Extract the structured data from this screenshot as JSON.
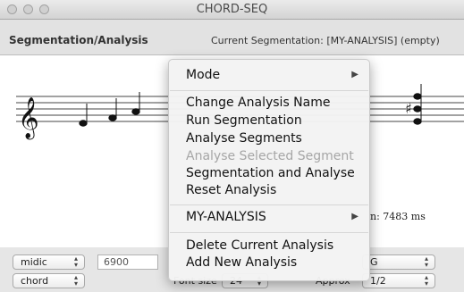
{
  "window": {
    "title": "CHORD-SEQ"
  },
  "toolbar": {
    "section_label": "Segmentation/Analysis",
    "current_segmentation": "Current Segmentation:  [MY-ANALYSIS] (empty)"
  },
  "canvas": {
    "duration_fragment": "n: 7483 ms"
  },
  "bottom": {
    "row1": {
      "format_select": "midic",
      "value_field": "6900",
      "key_select": "G"
    },
    "row2": {
      "mode_select": "chord",
      "font_size_label": "Font size",
      "font_size_select": "24",
      "approx_label": "Approx",
      "approx_select": "1/2"
    }
  },
  "context_menu": {
    "mode": "Mode",
    "change_name": "Change Analysis Name",
    "run_segmentation": "Run Segmentation",
    "analyse_segments": "Analyse Segments",
    "analyse_selected": "Analyse Selected Segment",
    "seg_and_analyse": "Segmentation and Analyse",
    "reset": "Reset Analysis",
    "my_analysis": "MY-ANALYSIS",
    "delete_current": "Delete Current Analysis",
    "add_new": "Add New Analysis"
  },
  "icons": {
    "submenu": "triangle-right-icon",
    "stepper": "up-down-arrows-icon",
    "clef": "treble-clef-icon",
    "sharp": "sharp-icon"
  }
}
